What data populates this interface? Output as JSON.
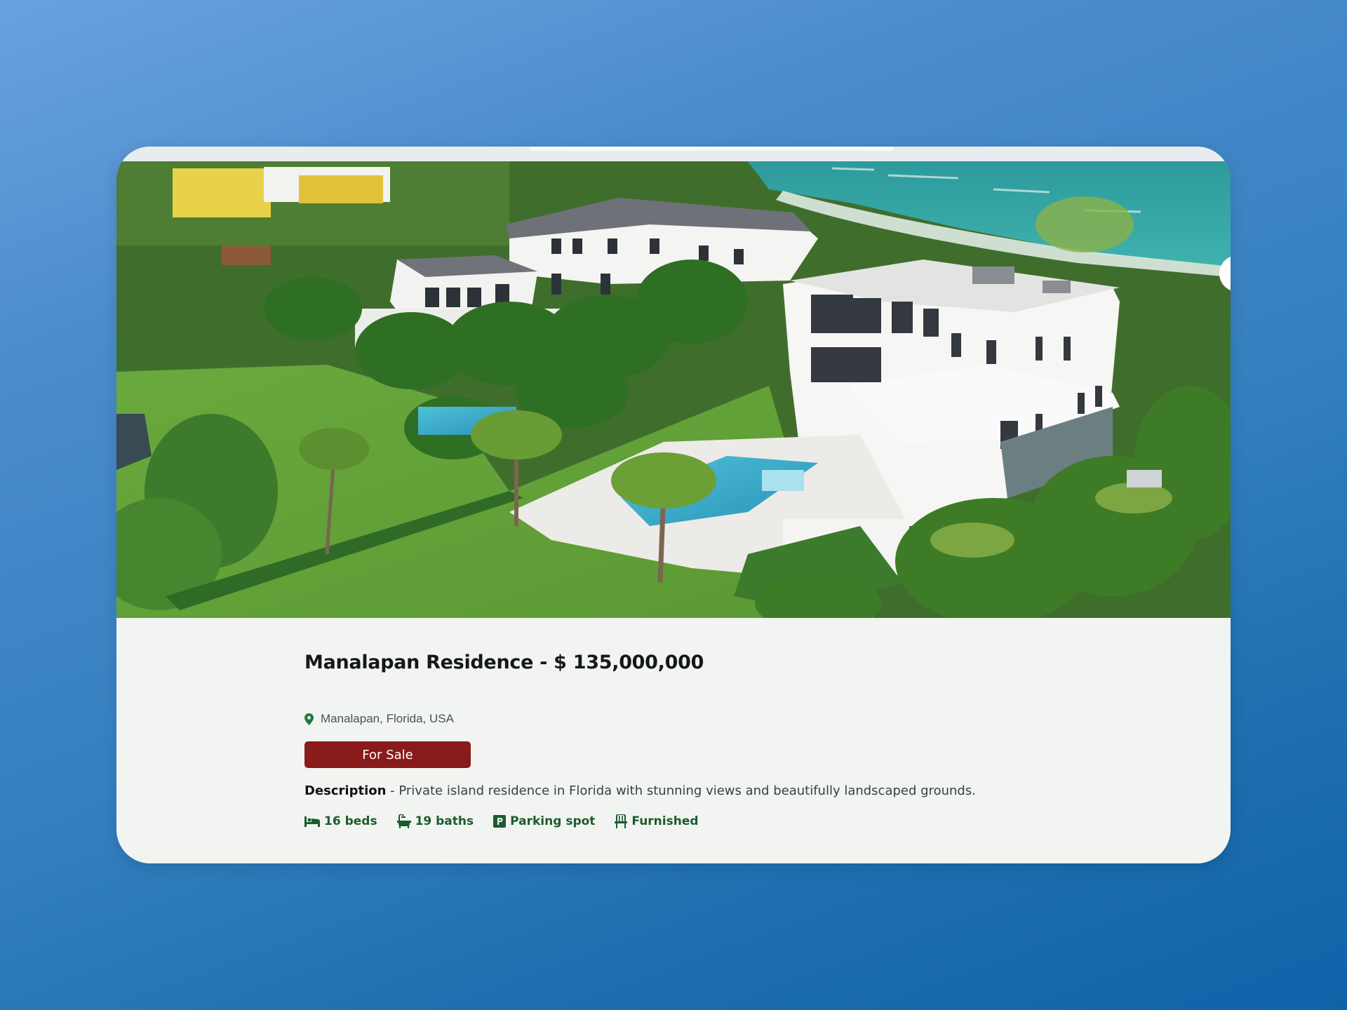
{
  "listing": {
    "title": "Manalapan Residence - $ 135,000,000",
    "location": "Manalapan, Florida, USA",
    "status": "For Sale",
    "description_label": "Description",
    "description_text": " - Private island residence in Florida with stunning views and beautifully landscaped grounds.",
    "features": {
      "beds": "16 beds",
      "baths": "19 baths",
      "parking": "Parking spot",
      "furnished": "Furnished"
    }
  },
  "icons": {
    "location": "map-pin-icon",
    "beds": "bed-icon",
    "baths": "bathtub-icon",
    "parking": "parking-icon",
    "furnished": "chair-icon"
  },
  "colors": {
    "status_badge": "#8a1b1b",
    "feature_text": "#1d5b2e",
    "card_background": "#f1f4f1"
  }
}
